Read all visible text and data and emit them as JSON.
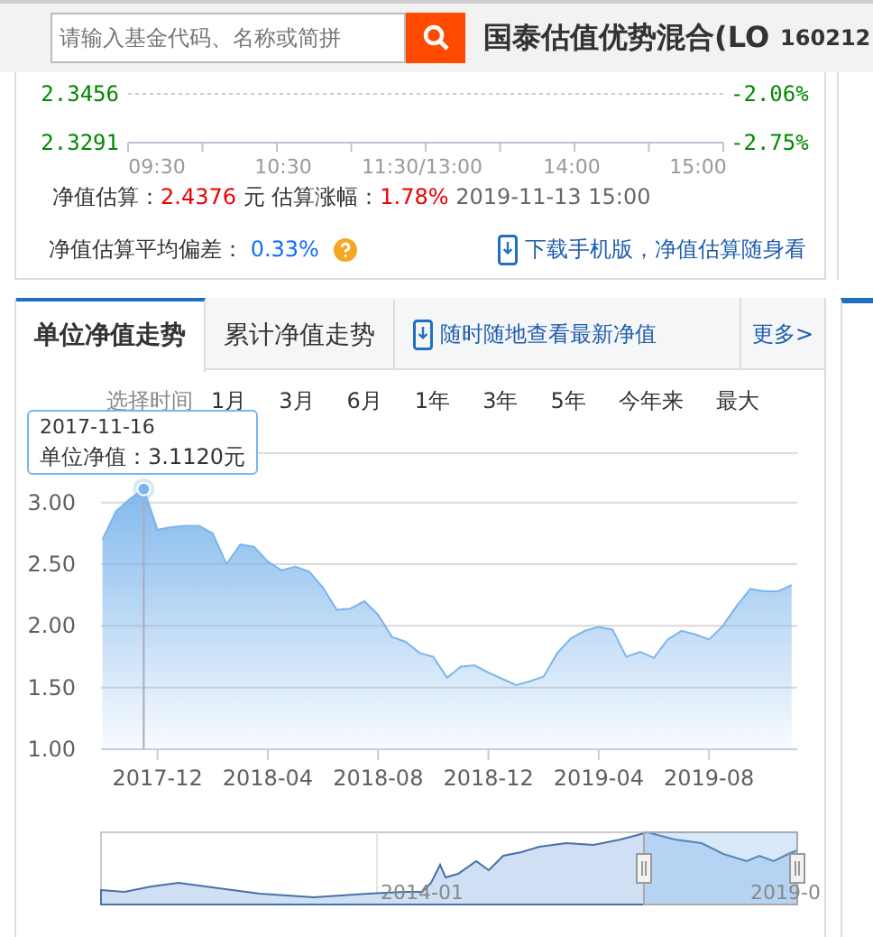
{
  "search": {
    "placeholder": "请输入基金代码、名称或简拼"
  },
  "fund": {
    "name": "国泰估值优势混合(LO",
    "code": "160212"
  },
  "intraday": {
    "left_labels": [
      "2.3456",
      "2.3291"
    ],
    "right_labels": [
      "-2.06%",
      "-2.75%"
    ],
    "time_labels": [
      "09:30",
      "10:30",
      "11:30/13:00",
      "14:00",
      "15:00"
    ]
  },
  "estimate": {
    "label": "净值估算：",
    "value": "2.4376",
    "unit": "元",
    "change_label": "估算涨幅：",
    "change": "1.78%",
    "time": "2019-11-13 15:00"
  },
  "deviation": {
    "label": "净值估算平均偏差：",
    "value": "0.33%"
  },
  "download_link": "下载手机版，净值估算随身看",
  "tabs": [
    {
      "label": "单位净值走势",
      "selected": true
    },
    {
      "label": "累计净值走势",
      "selected": false
    }
  ],
  "mobile_link": "随时随地查看最新净值",
  "more_link": "更多>",
  "range": {
    "label": "选择时间",
    "options": [
      {
        "label": "1月",
        "selected": false
      },
      {
        "label": "3月",
        "selected": false
      },
      {
        "label": "6月",
        "selected": false
      },
      {
        "label": "1年",
        "selected": false
      },
      {
        "label": "3年",
        "selected": false
      },
      {
        "label": "5年",
        "selected": false
      },
      {
        "label": "今年来",
        "selected": false
      },
      {
        "label": "最大",
        "selected": false
      }
    ]
  },
  "tooltip": {
    "date": "2017-11-16",
    "text": "单位净值：3.1120元"
  },
  "chart_data": {
    "type": "area",
    "grid": true,
    "ylim": [
      1,
      3.4
    ],
    "categories": [
      null,
      null,
      null,
      null,
      "2017-12",
      null,
      null,
      null,
      null,
      null,
      null,
      null,
      "2018-04",
      null,
      null,
      null,
      null,
      null,
      null,
      null,
      "2018-08",
      null,
      null,
      null,
      null,
      null,
      null,
      null,
      "2018-12",
      null,
      null,
      null,
      null,
      null,
      null,
      null,
      "2019-04",
      null,
      null,
      null,
      null,
      null,
      null,
      null,
      "2019-08",
      null,
      null,
      null,
      null,
      null,
      null
    ],
    "yticks": [
      {
        "value": 1,
        "label": "1.00"
      },
      {
        "value": 1.5,
        "label": "1.50"
      },
      {
        "value": 2,
        "label": "2.00"
      },
      {
        "value": 2.5,
        "label": "2.50"
      },
      {
        "value": 3,
        "label": "3.00"
      }
    ],
    "series": [
      {
        "color": "#7cb5ec",
        "values": [
          2.7,
          2.93,
          3.03,
          3.11,
          2.78,
          2.8,
          2.81,
          2.81,
          2.75,
          2.5,
          2.66,
          2.64,
          2.52,
          2.45,
          2.48,
          2.44,
          2.31,
          2.13,
          2.14,
          2.2,
          2.09,
          1.91,
          1.87,
          1.78,
          1.75,
          1.58,
          1.67,
          1.68,
          1.62,
          1.57,
          1.52,
          1.55,
          1.59,
          1.78,
          1.9,
          1.96,
          1.99,
          1.97,
          1.75,
          1.79,
          1.74,
          1.89,
          1.96,
          1.93,
          1.89,
          2.0,
          2.16,
          2.3,
          2.28,
          2.28,
          2.33
        ]
      }
    ]
  },
  "navigator": {
    "labels": [
      "2014-01",
      "2019-0"
    ]
  }
}
